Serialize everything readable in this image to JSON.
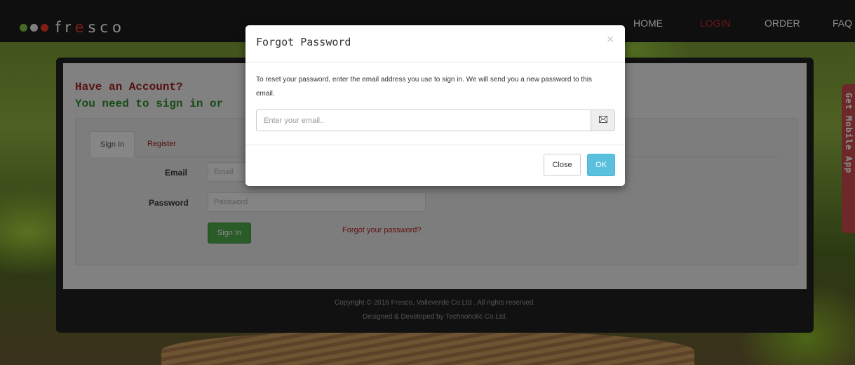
{
  "brand": {
    "logo_text_before": "fr",
    "logo_text_accent": "e",
    "logo_text_after": "sco"
  },
  "nav": {
    "home": "HOME",
    "login": "LOGIN",
    "order": "ORDER",
    "faq": "FAQ"
  },
  "page": {
    "heading_account": "Have an Account?",
    "heading_signin": "You need to sign in or"
  },
  "tabs": {
    "signin": "Sign In",
    "register": "Register"
  },
  "form": {
    "email_label": "Email",
    "email_placeholder": "Email",
    "password_label": "Password",
    "password_placeholder": "Password",
    "signin_button": "Sign In",
    "forgot_link": "Forgot your password?"
  },
  "footer": {
    "copyright": "Copyright © 2016 Fresco, Valleverde Co.Ltd . All rights reserved.",
    "credit": "Designed & Developed by Technoholic Co.Ltd."
  },
  "side_tab": {
    "label": "Get Mobile App"
  },
  "modal": {
    "title": "Forgot Password",
    "close_glyph": "×",
    "description": "To reset your password, enter the email address you use to sign in. We will send you a new password to this email.",
    "email_placeholder": "Enter your email..",
    "email_icon": "envelope-icon",
    "close_button": "Close",
    "ok_button": "OK"
  },
  "colors": {
    "brand_red": "#e8392b",
    "brand_green": "#7dc242",
    "ok_blue": "#5bc0de",
    "signin_green": "#4ca84c"
  }
}
